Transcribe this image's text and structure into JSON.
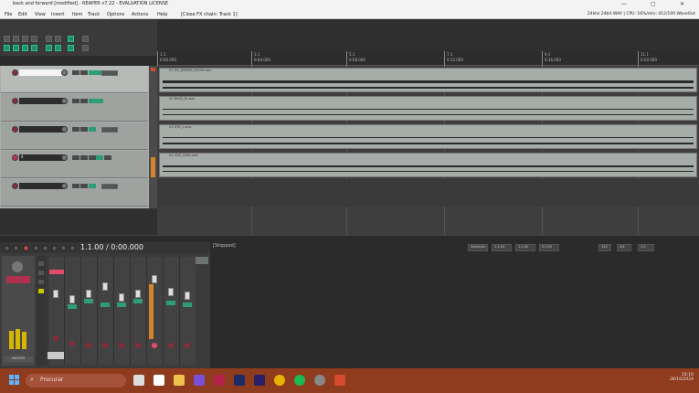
{
  "window": {
    "title": "back and forward [modified] - REAPER v7.22 - EVALUATION LICENSE",
    "controls": [
      "—",
      "▢",
      "✕"
    ]
  },
  "menu": {
    "items": [
      "File",
      "Edit",
      "View",
      "Insert",
      "Item",
      "Track",
      "Options",
      "Actions",
      "Help"
    ],
    "context": "[Close FX chain: Track 1]",
    "info": "24khz 24bit WAV | CPU: 16%/min: 412/100 WaveOut"
  },
  "ruler": {
    "marks": [
      {
        "bar": "1.1",
        "time": "0:00.000"
      },
      {
        "bar": "3.1",
        "time": "0:04.000"
      },
      {
        "bar": "5.1",
        "time": "0:08.000"
      },
      {
        "bar": "7.1",
        "time": "0:12.000"
      },
      {
        "bar": "9.1",
        "time": "0:16.000"
      },
      {
        "bar": "11.1",
        "time": "0:20.000"
      }
    ]
  },
  "tracks": [
    {
      "name": "",
      "selected": true
    },
    {
      "name": ""
    },
    {
      "name": ""
    },
    {
      "name": "4"
    },
    {
      "name": ""
    }
  ],
  "items": [
    "01 GH_DRUMS_ROOM.wav",
    "02 BASS_DI.wav",
    "03 GTR_L.wav",
    "04 VOX_LEAD.wav"
  ],
  "transport": {
    "time": "1.1.00 / 0:00.000",
    "status": "[Stopped]",
    "selection_label": "Selection:",
    "sel_start": "1.1.00",
    "sel_end": "1.1.00",
    "sel_len": "0.0.00",
    "bpm": "120",
    "timesig": "4/4",
    "rate": "1.0"
  },
  "mixer": {
    "master_label": "MASTER",
    "strip_count": 9
  },
  "taskbar": {
    "search_placeholder": "Procurar",
    "time": "22:10",
    "date": "28/10/2024"
  },
  "colors": {
    "accent_green": "#2e9d76",
    "record_red": "#8a2b3b",
    "taskbar": "#8e3b1e"
  }
}
